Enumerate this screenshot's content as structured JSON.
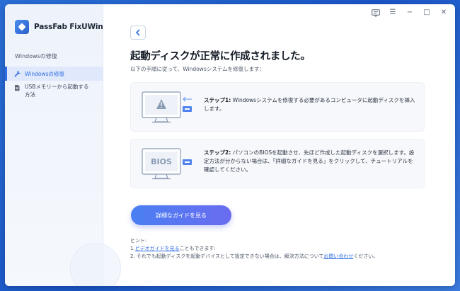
{
  "app": {
    "name": "PassFab FixUWin"
  },
  "window_controls": {
    "feedback": "feedback-icon",
    "menu": "☰",
    "minimize": "−",
    "maximize": "□",
    "close": "✕"
  },
  "sidebar": {
    "heading": "Windowsの修復",
    "items": [
      {
        "label": "Windowsの修復",
        "icon": "wrench-icon",
        "active": true
      },
      {
        "label_line1": "USBメモリーから起動する",
        "label_line2": "方法",
        "icon": "document-icon",
        "active": false
      }
    ]
  },
  "main": {
    "title": "起動ディスクが正常に作成されました。",
    "subtitle": "以下の手順に従って、Windowsシステムを修復します：",
    "steps": [
      {
        "label": "ステップ1:",
        "text": " Windowsシステムを修復する必要があるコンピュータに起動ディスクを挿入します。"
      },
      {
        "label": "ステップ2:",
        "text": " パソコンのBIOSを起動させ、先ほど作成した起動ディスクを選択します。設定方法が分からない場合は、「詳細なガイドを見る」をクリックして、チュートリアルを確認してください。",
        "bios_label": "BIOS"
      }
    ],
    "cta_label": "詳細なガイドを見る",
    "hint": {
      "heading": "ヒント:",
      "line1_prefix": "1.",
      "line1_link": "ビデオガイドを見る",
      "line1_suffix": "こともできます:",
      "line2_prefix": "2. それでも起動ディスクを起動デバイスとして設定できない場合は、解決方法について",
      "line2_link": "お問い合わせ",
      "line2_suffix": "ください。"
    }
  },
  "colors": {
    "accent": "#2f6de0",
    "cta_start": "#4a7ff2",
    "cta_end": "#6a6cf0",
    "warning": "#8a9bb5"
  }
}
